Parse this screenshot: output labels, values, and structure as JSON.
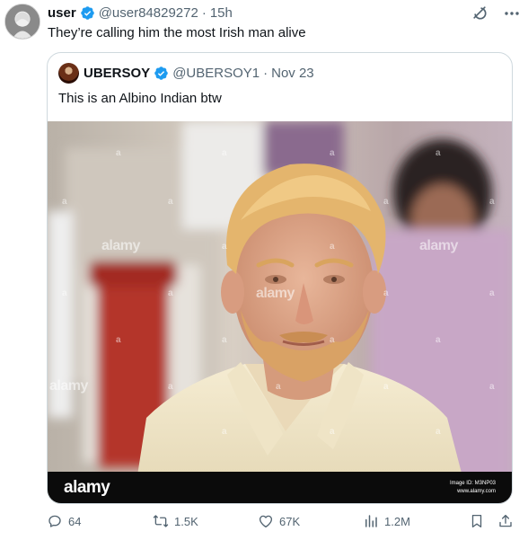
{
  "tweet": {
    "author_name": "user",
    "author_handle": "@user84829272",
    "separator": "·",
    "time": "15h",
    "text": "They’re calling him the most Irish man alive",
    "icons": {
      "avatar": "profile-avatar",
      "verified": "verified-badge-icon",
      "grok": "grok-icon",
      "more": "more-icon"
    }
  },
  "quoted": {
    "author_name": "UBERSOY",
    "author_handle": "@UBERSOY1",
    "separator": "·",
    "date": "Nov 23",
    "text": "This is an Albino Indian btw",
    "media": {
      "watermark": "alamy",
      "watermark_small": "a",
      "banner_logo": "alamy",
      "image_id": "Image ID: M3NP03",
      "site": "www.alamy.com"
    }
  },
  "actions": {
    "replies": "64",
    "reposts": "1.5K",
    "likes": "67K",
    "views": "1.2M",
    "icons": [
      "reply-icon",
      "repost-icon",
      "like-icon",
      "views-icon",
      "bookmark-icon",
      "share-icon"
    ]
  },
  "colors": {
    "text": "#0f1419",
    "secondary": "#536471",
    "verified": "#1d9bf0",
    "border": "#cfd9de"
  }
}
